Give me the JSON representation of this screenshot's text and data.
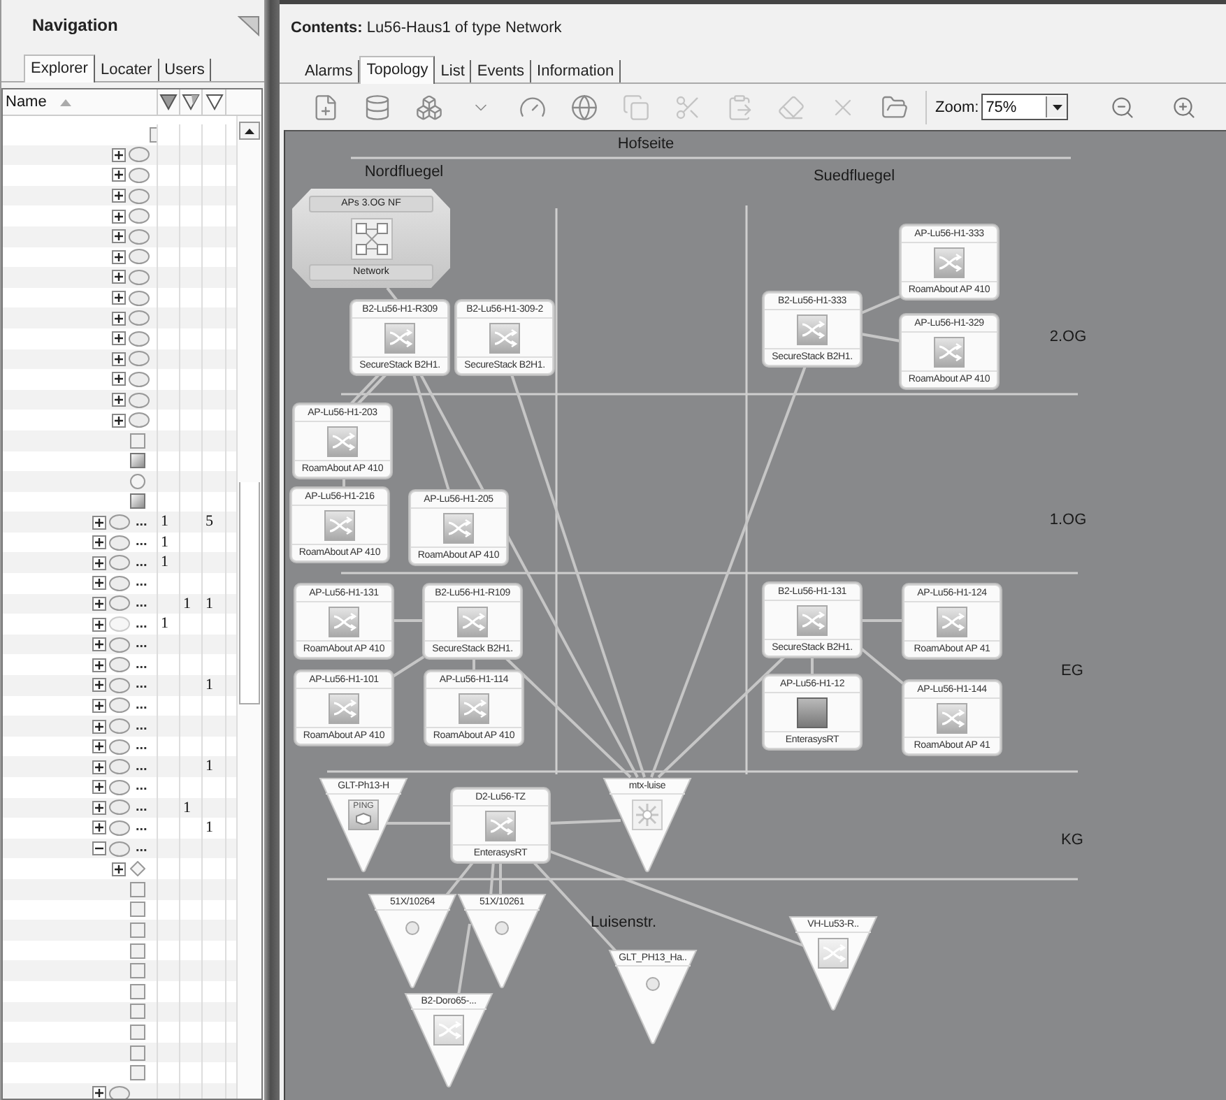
{
  "navigation": {
    "title": "Navigation",
    "tabs": [
      {
        "label": "Explorer",
        "selected": true
      },
      {
        "label": "Locater",
        "selected": false
      },
      {
        "label": "Users",
        "selected": false
      }
    ],
    "columns": {
      "name": "Name"
    },
    "tree": {
      "clipped_rows": [
        {
          "kind": "square"
        }
      ],
      "continued_rows": [
        {
          "kind": "oval",
          "expanded": false
        },
        {
          "kind": "oval",
          "expanded": false
        },
        {
          "kind": "oval",
          "expanded": false
        },
        {
          "kind": "oval",
          "expanded": false
        },
        {
          "kind": "oval",
          "expanded": false
        },
        {
          "kind": "oval",
          "expanded": false
        },
        {
          "kind": "oval",
          "expanded": false
        },
        {
          "kind": "oval",
          "expanded": false
        },
        {
          "kind": "oval",
          "expanded": false
        },
        {
          "kind": "oval",
          "expanded": false
        },
        {
          "kind": "oval",
          "expanded": false
        },
        {
          "kind": "oval",
          "expanded": false
        },
        {
          "kind": "oval",
          "expanded": false
        },
        {
          "kind": "oval",
          "expanded": false
        },
        {
          "kind": "square"
        },
        {
          "kind": "shaded-square"
        },
        {
          "kind": "circle"
        },
        {
          "kind": "shaded-square"
        }
      ],
      "rows": [
        {
          "kind": "oval",
          "expanded": false,
          "name": "...",
          "col_1": "1",
          "col_3": "5"
        },
        {
          "kind": "oval",
          "expanded": false,
          "name": "...",
          "col_1": "1"
        },
        {
          "kind": "oval",
          "expanded": false,
          "name": "...",
          "col_1": "1"
        },
        {
          "kind": "oval",
          "expanded": false,
          "name": "..."
        },
        {
          "kind": "oval",
          "expanded": false,
          "name": "...",
          "col_2": "1",
          "col_3": "1"
        },
        {
          "kind": "faded-oval",
          "expanded": false,
          "name": "...",
          "col_1": "1"
        },
        {
          "kind": "oval",
          "expanded": false,
          "name": "..."
        },
        {
          "kind": "oval",
          "expanded": false,
          "name": "..."
        },
        {
          "kind": "oval",
          "expanded": false,
          "name": "...",
          "col_3": "1"
        },
        {
          "kind": "oval",
          "expanded": false,
          "name": "..."
        },
        {
          "kind": "oval",
          "expanded": false,
          "name": "..."
        },
        {
          "kind": "oval",
          "expanded": false,
          "name": "..."
        },
        {
          "kind": "oval",
          "expanded": false,
          "name": "...",
          "col_3": "1"
        },
        {
          "kind": "oval",
          "expanded": false,
          "name": "..."
        },
        {
          "kind": "oval",
          "expanded": false,
          "name": "...",
          "col_2": "1"
        },
        {
          "kind": "oval",
          "expanded": false,
          "name": "...",
          "col_3": "1"
        },
        {
          "kind": "oval",
          "expanded": true,
          "name": "...",
          "children": [
            {
              "kind": "diamond",
              "expanded": false
            },
            {
              "kind": "square"
            },
            {
              "kind": "square"
            },
            {
              "kind": "square"
            },
            {
              "kind": "square"
            },
            {
              "kind": "square"
            },
            {
              "kind": "square"
            },
            {
              "kind": "square"
            },
            {
              "kind": "square"
            },
            {
              "kind": "square"
            },
            {
              "kind": "square"
            }
          ]
        },
        {
          "kind": "oval",
          "expanded": false
        }
      ]
    }
  },
  "contents": {
    "title": "**Contents:** Lu56-Haus1 of type Network",
    "tabs": [
      {
        "label": "Alarms",
        "selected": false
      },
      {
        "label": "Topology",
        "selected": true
      },
      {
        "label": "List",
        "selected": false
      },
      {
        "label": "Events",
        "selected": false
      },
      {
        "label": "Information",
        "selected": false
      }
    ],
    "toolbar": {
      "buttons": [
        {
          "disabled": false
        },
        {
          "disabled": false
        },
        {
          "disabled": false
        },
        {
          "disabled": false
        },
        {
          "disabled": false
        },
        {
          "disabled": false
        },
        {
          "disabled": true
        },
        {
          "disabled": true
        },
        {
          "disabled": true
        },
        {
          "disabled": true
        },
        {
          "disabled": true
        },
        {
          "disabled": false
        }
      ],
      "zoom_label": "Zoom:",
      "zoom_value": "75%"
    },
    "topology": {
      "labels": [
        "Hofseite",
        "Nordfluegel",
        "Suedfluegel",
        "2.OG",
        "1.OG",
        "EG",
        "KG",
        "Luisenstr."
      ],
      "nodes": [
        {
          "kind": "group",
          "title": "APs 3.OG NF",
          "subtitle": "Network"
        },
        {
          "kind": "switch-card",
          "title": "B2-Lu56-H1-R309",
          "subtitle": "SecureStack B2H1."
        },
        {
          "kind": "switch-card",
          "title": "B2-Lu56-H1-309-2",
          "subtitle": "SecureStack B2H1."
        },
        {
          "kind": "switch-card",
          "title": "AP-Lu56-H1-333",
          "subtitle": "RoamAbout AP 410"
        },
        {
          "kind": "switch-card",
          "title": "B2-Lu56-H1-333",
          "subtitle": "SecureStack B2H1."
        },
        {
          "kind": "switch-card",
          "title": "AP-Lu56-H1-329",
          "subtitle": "RoamAbout AP 410"
        },
        {
          "kind": "switch-card",
          "title": "AP-Lu56-H1-203",
          "subtitle": "RoamAbout AP 410"
        },
        {
          "kind": "switch-card",
          "title": "AP-Lu56-H1-216",
          "subtitle": "RoamAbout AP 410"
        },
        {
          "kind": "switch-card",
          "title": "AP-Lu56-H1-205",
          "subtitle": "RoamAbout AP 410"
        },
        {
          "kind": "switch-card",
          "title": "AP-Lu56-H1-131",
          "subtitle": "RoamAbout AP 410"
        },
        {
          "kind": "switch-card",
          "title": "B2-Lu56-H1-R109",
          "subtitle": "SecureStack B2H1."
        },
        {
          "kind": "switch-card",
          "title": "B2-Lu56-H1-131",
          "subtitle": "SecureStack B2H1."
        },
        {
          "kind": "switch-card",
          "title": "AP-Lu56-H1-124",
          "subtitle": "RoamAbout AP 41"
        },
        {
          "kind": "switch-card",
          "title": "AP-Lu56-H1-101",
          "subtitle": "RoamAbout AP 410"
        },
        {
          "kind": "switch-card",
          "title": "AP-Lu56-H1-114",
          "subtitle": "RoamAbout AP 410"
        },
        {
          "kind": "router-card",
          "title": "AP-Lu56-H1-12",
          "subtitle": "EnterasysRT"
        },
        {
          "kind": "switch-card",
          "title": "AP-Lu56-H1-144",
          "subtitle": "RoamAbout AP 41"
        },
        {
          "kind": "ping-triangle",
          "title": "GLT-Ph13-H",
          "icon_label": "PING"
        },
        {
          "kind": "switch-card",
          "title": "D2-Lu56-TZ",
          "subtitle": "EnterasysRT"
        },
        {
          "kind": "hub-triangle",
          "title": "mtx-luise"
        },
        {
          "kind": "dot-triangle",
          "title": "51X/10264"
        },
        {
          "kind": "dot-triangle",
          "title": "51X/10261"
        },
        {
          "kind": "dot-triangle",
          "title": "GLT_PH13_Ha.."
        },
        {
          "kind": "switch-triangle",
          "title": "VH-Lu53-R.."
        },
        {
          "kind": "switch-triangle",
          "title": "B2-Doro65-..."
        }
      ]
    }
  }
}
